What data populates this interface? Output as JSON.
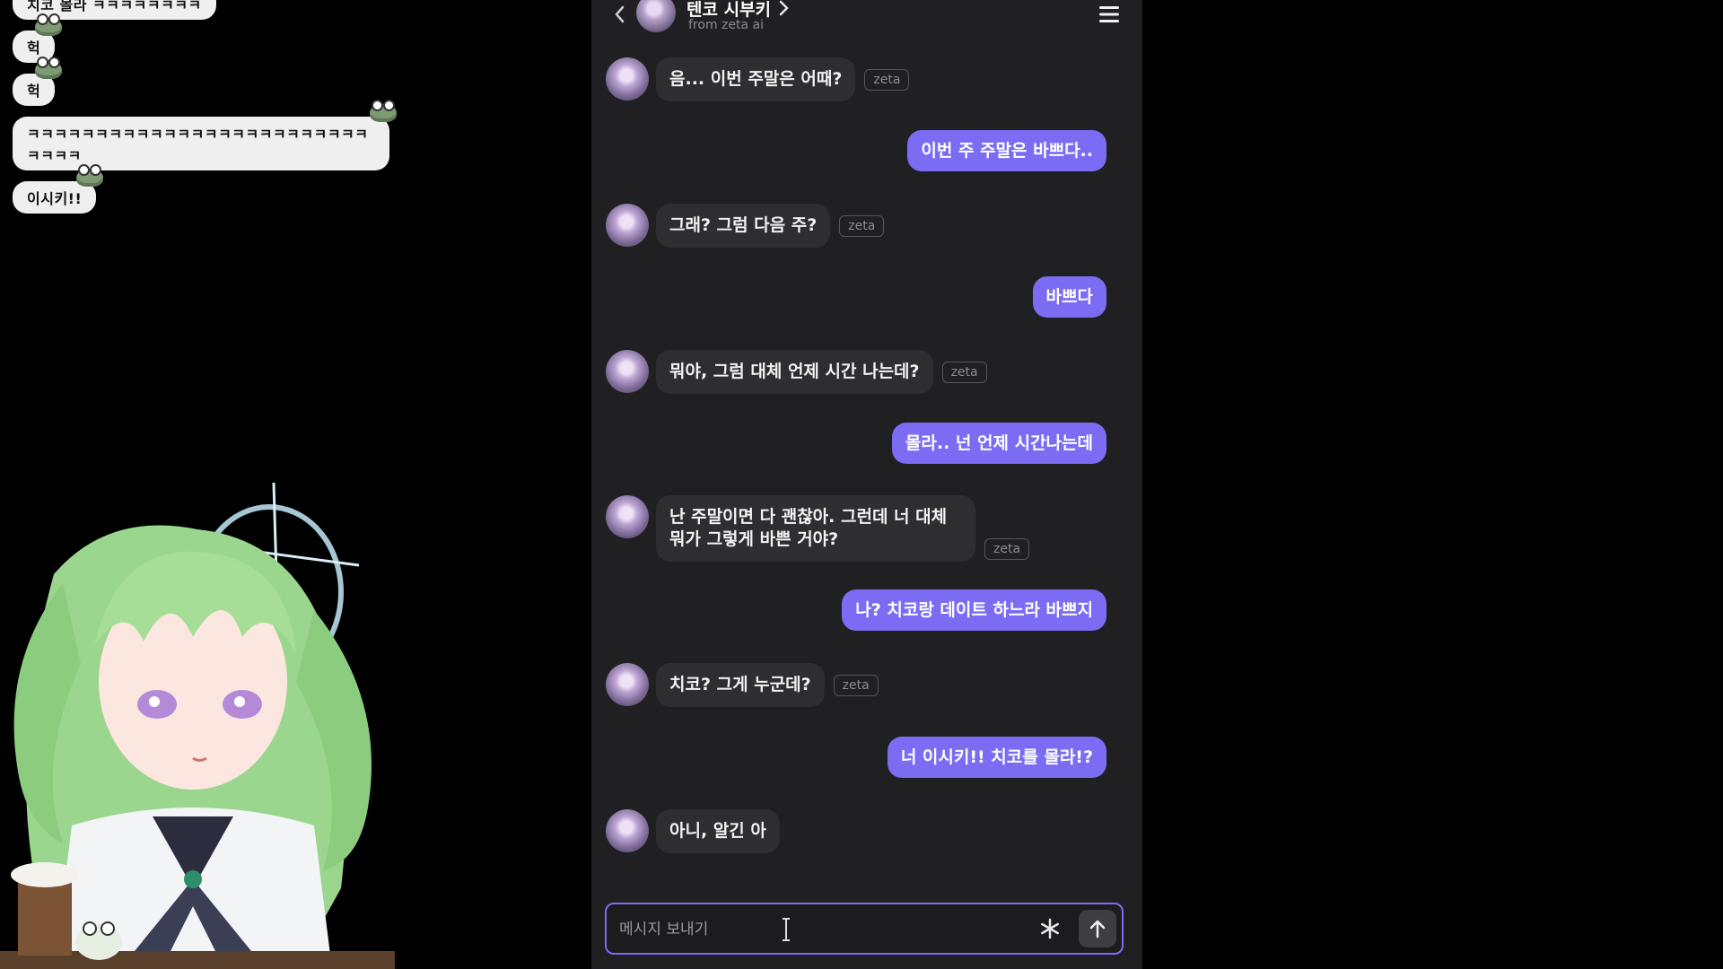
{
  "stream_chat": {
    "messages": [
      "치코 몰라 ㅋㅋㅋㅋㅋㅋㅋㅋ",
      "헉",
      "헉",
      "ㅋㅋㅋㅋㅋㅋㅋㅋㅋㅋㅋㅋㅋㅋㅋㅋㅋㅋㅋㅋㅋㅋㅋㅋㅋㅋㅋㅋㅋ",
      "이시키!!"
    ]
  },
  "header": {
    "character_name": "텐코 시부키",
    "source": "from zeta ai",
    "icons": [
      "back-chevron",
      "profile-chevron",
      "hamburger-menu"
    ]
  },
  "conversation": [
    {
      "role": "ai",
      "text": "음... 이번 주말은 어때?",
      "tag": "zeta"
    },
    {
      "role": "user",
      "text": "이번 주 주말은 바쁘다.."
    },
    {
      "role": "ai",
      "text": "그래? 그럼 다음 주?",
      "tag": "zeta"
    },
    {
      "role": "user",
      "text": "바쁘다"
    },
    {
      "role": "ai",
      "text": "뭐야, 그럼 대체 언제 시간 나는데?",
      "tag": "zeta"
    },
    {
      "role": "user",
      "text": "몰라.. 넌 언제 시간나는데"
    },
    {
      "role": "ai",
      "text": "난 주말이면 다 괜찮아. 그런데 너 대체 뭐가 그렇게 바쁜 거야?",
      "tag": "zeta"
    },
    {
      "role": "user",
      "text": "나? 치코랑 데이트 하느라 바쁘지"
    },
    {
      "role": "ai",
      "text": "치코? 그게 누군데?",
      "tag": "zeta"
    },
    {
      "role": "user",
      "text": "너 이시키!! 치코를 몰라!?"
    },
    {
      "role": "ai",
      "text": "아니, 알긴 아"
    }
  ],
  "composer": {
    "placeholder": "메시지 보내기",
    "icons": [
      "asterisk-icon",
      "send-arrow-icon"
    ]
  },
  "colors": {
    "app_background": "#202022",
    "ai_bubble": "#2e2e31",
    "user_bubble": "#7c6cf4",
    "accent_border": "#7c6cf4",
    "page_background": "#000000"
  }
}
